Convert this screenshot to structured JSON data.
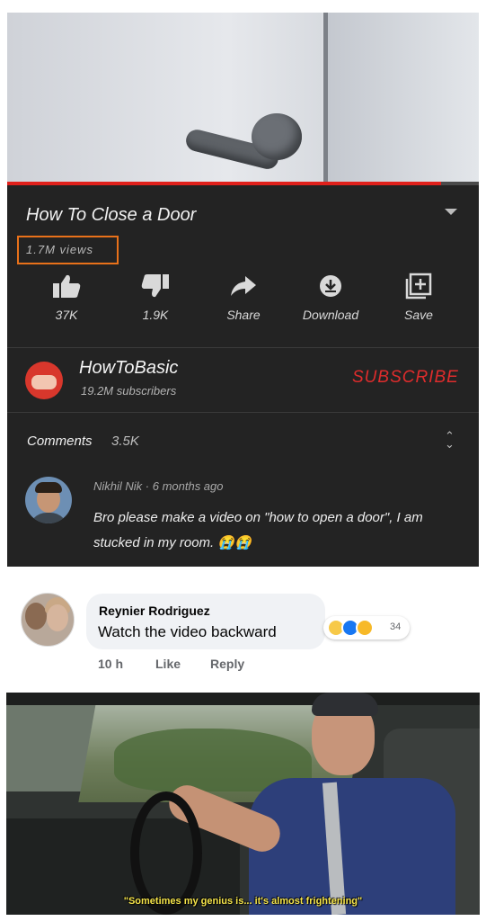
{
  "video": {
    "title": "How To Close a Door",
    "views": "1.7M views",
    "progress": 0.92,
    "actions": [
      {
        "icon": "thumbs-up-icon",
        "label": "37K"
      },
      {
        "icon": "thumbs-down-icon",
        "label": "1.9K"
      },
      {
        "icon": "share-icon",
        "label": "Share"
      },
      {
        "icon": "download-icon",
        "label": "Download"
      },
      {
        "icon": "save-icon",
        "label": "Save"
      }
    ]
  },
  "channel": {
    "name": "HowToBasic",
    "subscribers": "19.2M subscribers",
    "subscribe_label": "SUBSCRIBE",
    "brand_color": "#df2c2c"
  },
  "comments": {
    "label": "Comments",
    "count": "3.5K",
    "top_comment": {
      "meta": "Nikhil Nik · 6 months ago",
      "text": "Bro please make a video on \"how to open a door\", I am stucked in my room. 😭😭"
    }
  },
  "facebook_reply": {
    "author": "Reynier Rodriguez",
    "text": "Watch the video backward",
    "reactions": [
      "haha",
      "like",
      "wow"
    ],
    "reaction_count": "34",
    "time": "10 h",
    "like_label": "Like",
    "reply_label": "Reply"
  },
  "meme": {
    "caption": "\"Sometimes my genius is... it's almost frightening\""
  }
}
